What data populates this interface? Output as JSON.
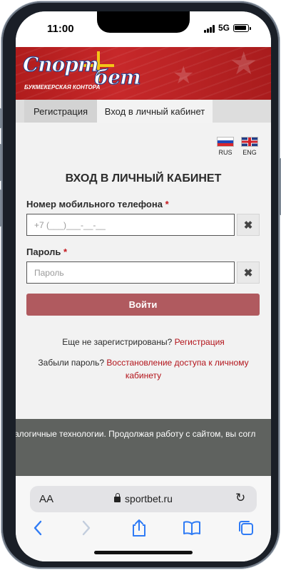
{
  "status_bar": {
    "time": "11:00",
    "network": "5G"
  },
  "tabs": {
    "register": "Регистрация",
    "login": "Вход в личный кабинет"
  },
  "languages": [
    {
      "code": "RUS"
    },
    {
      "code": "ENG"
    }
  ],
  "brand": {
    "sub_caption": "БУКМЕКЕРСКАЯ КОНТОРА"
  },
  "form": {
    "title": "ВХОД В ЛИЧНЫЙ КАБИНЕТ",
    "phone_label": "Номер мобильного телефона",
    "phone_placeholder": "+7 (___)___-__-__",
    "password_label": "Пароль",
    "password_placeholder": "Пароль",
    "required_mark": "*",
    "submit": "Войти"
  },
  "links": {
    "not_registered_text": "Еще не зарегистрированы?",
    "register_link": "Регистрация",
    "forgot_text": "Забыли пароль?",
    "restore_link_line1": "Восстановление доступа к личному",
    "restore_link_line2": "кабинету"
  },
  "cookie_notice": "алогичные технологии. Продолжая работу с сайтом, вы согл",
  "browser": {
    "aa": "AA",
    "url": "sportbet.ru"
  },
  "colors": {
    "brand_red": "#c7282a",
    "button": "#b05a5f",
    "link": "#b3141b"
  }
}
